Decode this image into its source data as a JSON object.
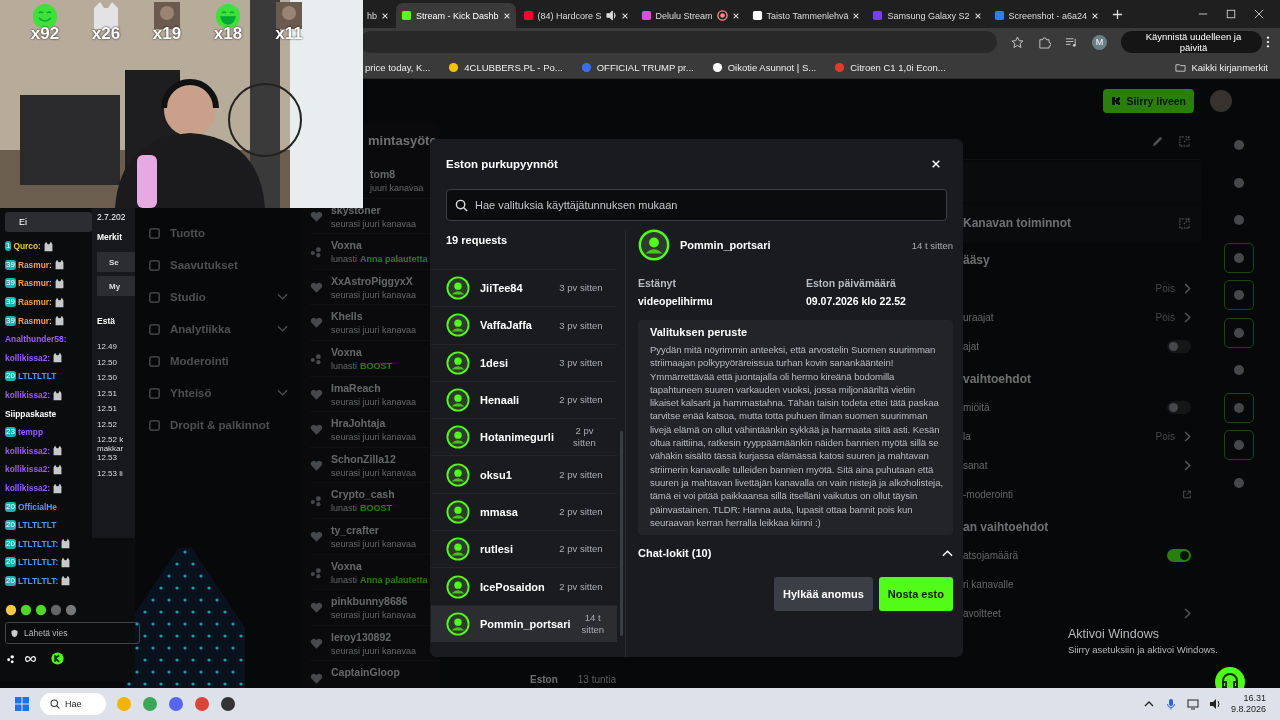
{
  "browser": {
    "tabs": [
      {
        "label": "hb",
        "kind": "generic",
        "selected": false
      },
      {
        "label": "Stream - Kick Dashb",
        "kind": "kick",
        "selected": true
      },
      {
        "label": "(84) Hardcore S",
        "kind": "youtube",
        "selected": false
      },
      {
        "label": "Delulu Stream",
        "kind": "delulu",
        "selected": false
      },
      {
        "label": "Taisto Tammenlehvä",
        "kind": "x",
        "selected": false
      },
      {
        "label": "Samsung Galaxy S2",
        "kind": "samsung",
        "selected": false
      },
      {
        "label": "Screenshot - a6a24",
        "kind": "screenshot",
        "selected": false
      }
    ],
    "profile": "M",
    "update_button": "Käynnistä uudelleen ja päivitä",
    "bookmarks": [
      {
        "label": "price today, K...",
        "kind": "none"
      },
      {
        "label": "4CLUBBERS.PL - Po...",
        "kind": "clubbers"
      },
      {
        "label": "OFFICIAL TRUMP pr...",
        "kind": "trump"
      },
      {
        "label": "Oikotie Asunnot | S...",
        "kind": "oikotie"
      },
      {
        "label": "Citroen C1 1,0i Econ...",
        "kind": "citroen"
      }
    ],
    "all_bookmarks": "Kaikki kirjanmerkit"
  },
  "dashboard": {
    "go_live": "Siirry liveen",
    "nav": [
      {
        "label": "Tuotto",
        "chevron": false
      },
      {
        "label": "Saavutukset",
        "chevron": false
      },
      {
        "label": "Studio",
        "chevron": true
      },
      {
        "label": "Analytiikka",
        "chevron": true
      },
      {
        "label": "Moderointi",
        "chevron": false
      },
      {
        "label": "Yhteisö",
        "chevron": true
      },
      {
        "label": "Dropit & palkinnot",
        "chevron": false
      }
    ],
    "feed_title": "mintasyöte",
    "feed": [
      {
        "name": "tom8",
        "kind": "follow",
        "action": "juuri kanavaa"
      },
      {
        "name": "skystoner",
        "kind": "follow",
        "action": "seurasi juuri kanavaa"
      },
      {
        "name": "Voxna",
        "kind": "redeem",
        "action": "lunasti",
        "reward": "Anna palautetta"
      },
      {
        "name": "XxAstroPiggyxX",
        "kind": "follow",
        "action": "seurasi juuri kanavaa"
      },
      {
        "name": "Khells",
        "kind": "follow",
        "action": "seurasi juuri kanavaa"
      },
      {
        "name": "Voxna",
        "kind": "redeem",
        "action": "lunasti",
        "reward": "BOOST"
      },
      {
        "name": "ImaReach",
        "kind": "follow",
        "action": "seurasi juuri kanavaa"
      },
      {
        "name": "HraJohtaja",
        "kind": "follow",
        "action": "seurasi juuri kanavaa"
      },
      {
        "name": "SchonZilla12",
        "kind": "follow",
        "action": "seurasi juuri kanavaa"
      },
      {
        "name": "Crypto_cash",
        "kind": "redeem",
        "action": "lunasti",
        "reward": "BOOST"
      },
      {
        "name": "ty_crafter",
        "kind": "follow",
        "action": "seurasi juuri kanavaa"
      },
      {
        "name": "Voxna",
        "kind": "redeem",
        "action": "lunasti",
        "reward": "Anna palautetta"
      },
      {
        "name": "pinkbunny8686",
        "kind": "follow",
        "action": "seurasi juuri kanavaa"
      },
      {
        "name": "leroy130892",
        "kind": "follow",
        "action": "seurasi juuri kanavaa"
      },
      {
        "name": "CaptainGloop",
        "kind": "follow"
      }
    ],
    "behind_row": {
      "label": "Eston",
      "time": "13 tuntia"
    },
    "channel_title": "Kanavan toiminnot",
    "panel_rows": [
      {
        "kind": "section",
        "label": "ääsy"
      },
      {
        "kind": "value",
        "label": "",
        "value": "Pois"
      },
      {
        "kind": "value",
        "label": "uraajat",
        "value": "Pois"
      },
      {
        "kind": "toggle",
        "label": "ajat",
        "on": false
      },
      {
        "kind": "section",
        "label": "vaihtoehdot"
      },
      {
        "kind": "toggle",
        "label": "miöitä",
        "on": false
      },
      {
        "kind": "value",
        "label": "la",
        "value": "Pois"
      },
      {
        "kind": "arrow",
        "label": "sanat"
      },
      {
        "kind": "external",
        "label": "-moderointi"
      },
      {
        "kind": "section",
        "label": "an vaihtoehdot"
      },
      {
        "kind": "toggle",
        "label": "atsojamäärä",
        "on": true
      },
      {
        "kind": "plain",
        "label": "ri kanavalle"
      },
      {
        "kind": "arrow",
        "label": "avoitteet"
      }
    ]
  },
  "modal": {
    "title": "Eston purkupyynnöt",
    "search": {
      "placeholder": "Hae valituksia käyttäjätunnuksen mukaan"
    },
    "count": "19 requests",
    "requests": [
      {
        "name": "JiiTee84",
        "time": "3 pv sitten",
        "selected": false
      },
      {
        "name": "VaffaJaffa",
        "time": "3 pv sitten",
        "selected": false
      },
      {
        "name": "1desi",
        "time": "3 pv sitten",
        "selected": false
      },
      {
        "name": "Henaali",
        "time": "2 pv sitten",
        "selected": false
      },
      {
        "name": "Hotanimegurli",
        "time": "2 pv sitten",
        "selected": false
      },
      {
        "name": "oksu1",
        "time": "2 pv sitten",
        "selected": false
      },
      {
        "name": "mmasa",
        "time": "2 pv sitten",
        "selected": false
      },
      {
        "name": "rutlesi",
        "time": "2 pv sitten",
        "selected": false
      },
      {
        "name": "IcePosaidon",
        "time": "2 pv sitten",
        "selected": false
      },
      {
        "name": "Pommin_portsari",
        "time": "14 t sitten",
        "selected": true
      }
    ],
    "detail": {
      "name": "Pommin_portsari",
      "time": "14 t sitten",
      "blocked_by_label": "Estänyt",
      "blocked_by": "videopelihirmu",
      "date_label": "Eston päivämäärä",
      "date": "09.07.2026 klo 22.52",
      "reason_title": "Valituksen peruste",
      "reason": "Pyydän mitä nöyrimmin anteeksi, että arvostelin Suomen suurimman striimaajan polkypyöräreissua turhan kovin sanankääntein! Ymmärrettävää että juontajalla oli hermo kireänä bodomilla tapahtuneen suuren varkauden vuoksi, jossa miljonääriltä vietiin likaiset kalsarit ja hammastahna. Tähän taisin todeta ettei tätä paskaa tarvitse enää katsoa, mutta totta puhuen ilman suomen suurimman livejä elämä on ollut vähintäänkin sykkää ja harmaata siitä asti. Kesän oltua raittiina, ratkesin ryyppäämäänkin näiden bannien myötä sillä se vähäkin sisältö tässä kurjassa elämässä katosi suuren ja mahtavan striimerin kanavalle tulleiden bannien myötä. Sitä aina puhutaan että suuren ja mahtavan livettäjän kanavalla on vain nistejä ja alkoholisteja, tämä ei voi pitää paikkaansa sillä itselläni vaikutus on ollut täysin päinvastainen. TLDR: Hanna auta, lupasit ottaa bannit pois kun seuraavan kerran herralla leikkaa kiinni :)",
      "chat_logs": {
        "label": "Chat-lokit (10)",
        "expanded": true
      }
    },
    "buttons": [
      {
        "label": "Hylkää anomus",
        "kind": "secondary"
      },
      {
        "label": "Nosta esto",
        "kind": "primary"
      }
    ]
  },
  "stream": {
    "kind": "picture",
    "emote_counts": [
      {
        "count": "x92",
        "kind": "smile"
      },
      {
        "count": "x26",
        "kind": "cat"
      },
      {
        "count": "x19"
      },
      {
        "count": "x18",
        "kind": "laugh"
      },
      {
        "count": "x11"
      }
    ],
    "chat": {
      "filter": "Ei",
      "messages": [
        {
          "name": "Qurco:",
          "color": "#e8c93a",
          "badge": "1",
          "emote": true
        },
        {
          "name": "Rasmur:",
          "color": "#f0a050",
          "badge": "39",
          "emote": true
        },
        {
          "name": "Rasmur:",
          "color": "#f0a050",
          "badge": "39",
          "emote": true
        },
        {
          "name": "Rasmur:",
          "color": "#f0a050",
          "badge": "39",
          "emote": true
        },
        {
          "name": "Rasmur:",
          "color": "#f0a050",
          "badge": "39",
          "emote": true
        },
        {
          "name": "Analthunder58:",
          "color": "#9b5cff",
          "emote": false
        },
        {
          "name": "kollikissa2:",
          "color": "#9b5cff",
          "emote": true
        },
        {
          "name": "LTLTLTLT",
          "color": "#4a9cff",
          "badge": "20",
          "emote": false
        },
        {
          "name": "kollikissa2:",
          "color": "#9b5cff",
          "emote": true
        },
        {
          "name": "Siippaskaste",
          "color": "#ffffff",
          "emote": false
        },
        {
          "name": "tempp",
          "color": "#9b5cff",
          "badge": "23",
          "emote": false
        },
        {
          "name": "kollikissa2:",
          "color": "#9b5cff",
          "emote": true
        },
        {
          "name": "kollikissa2:",
          "color": "#9b5cff",
          "emote": true
        },
        {
          "name": "kollikissa2:",
          "color": "#9b5cff",
          "emote": true
        },
        {
          "name": "OfficialHe",
          "color": "#4a9cff",
          "badge": "20",
          "emote": false
        },
        {
          "name": "LTLTLTLT",
          "color": "#4a9cff",
          "badge": "20",
          "emote": false
        },
        {
          "name": "LTLTLTLT:",
          "color": "#4a9cff",
          "badge": "20",
          "emote": true
        },
        {
          "name": "LTLTLTLT:",
          "color": "#4a9cff",
          "badge": "20",
          "emote": true
        },
        {
          "name": "LTLTLTLT:",
          "color": "#4a9cff",
          "badge": "20",
          "emote": true
        }
      ],
      "input": {
        "placeholder": "Lähetä vies"
      }
    },
    "side_panel": {
      "date": "2.7.202",
      "heading": "Merkit",
      "buttons": [
        "Se",
        "My"
      ],
      "block_label": "Estä",
      "times": [
        "12.49",
        "12.50",
        "12.50",
        "12.51",
        "12.51",
        "12.52",
        "12.52 k makkar",
        "12.53",
        "12.53 li"
      ]
    }
  },
  "windows_notice": {
    "title": "Aktivoi Windows",
    "text": "Siirry asetuksiin ja aktivoi Windows."
  },
  "taskbar": {
    "search": "Hae",
    "time": "16.31",
    "date": "9.8.2026"
  }
}
